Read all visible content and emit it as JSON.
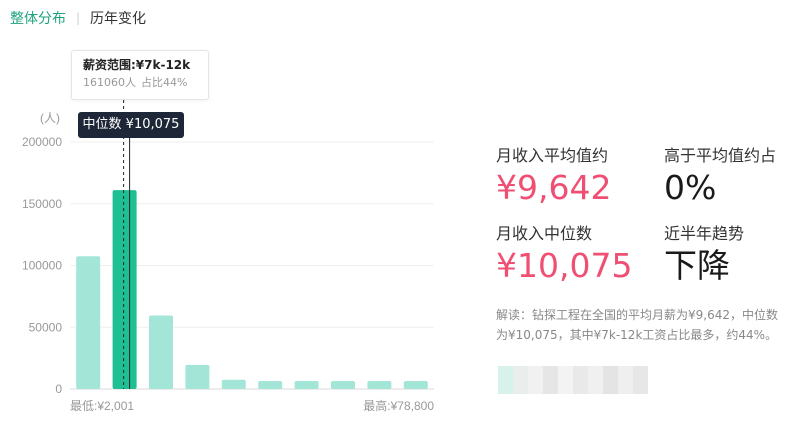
{
  "tabs": [
    {
      "label": "整体分布",
      "active": true
    },
    {
      "label": "历年变化",
      "active": false
    }
  ],
  "tooltip": {
    "title": "薪资范围:¥7k-12k",
    "count": "161060人",
    "share": "占比44%"
  },
  "median_label": "中位数 ¥10,075",
  "stats": {
    "avg_label": "月收入平均值约",
    "avg_value": "¥9,642",
    "above_label": "高于平均值约占",
    "above_value": "0%",
    "median_label": "月收入中位数",
    "median_value": "¥10,075",
    "trend_label": "近半年趋势",
    "trend_value": "下降"
  },
  "note": "解读：钻探工程在全国的平均月薪为¥9,642，中位数为¥10,075，其中¥7k-12k工资占比最多，约44%。",
  "colors": {
    "bar": "#a3e5d6",
    "bar_highlight": "#1ebf92",
    "accent_green": "#1fa37f",
    "value_pink": "#ee4f73",
    "tooltip_dark": "#1e2738"
  },
  "chart_data": {
    "type": "bar",
    "ylabel": "(人)",
    "y_ticks": [
      "0",
      "50000",
      "100000",
      "150000",
      "200000"
    ],
    "ylim": [
      0,
      200000
    ],
    "values": [
      107500,
      161060,
      59500,
      19500,
      7500,
      6500,
      6500,
      6500,
      6500,
      6500
    ],
    "highlight_index": 1,
    "x_min_label": "最低:¥2,001",
    "x_max_label": "最高:¥78,800",
    "median_value": 10075,
    "grid": true
  }
}
